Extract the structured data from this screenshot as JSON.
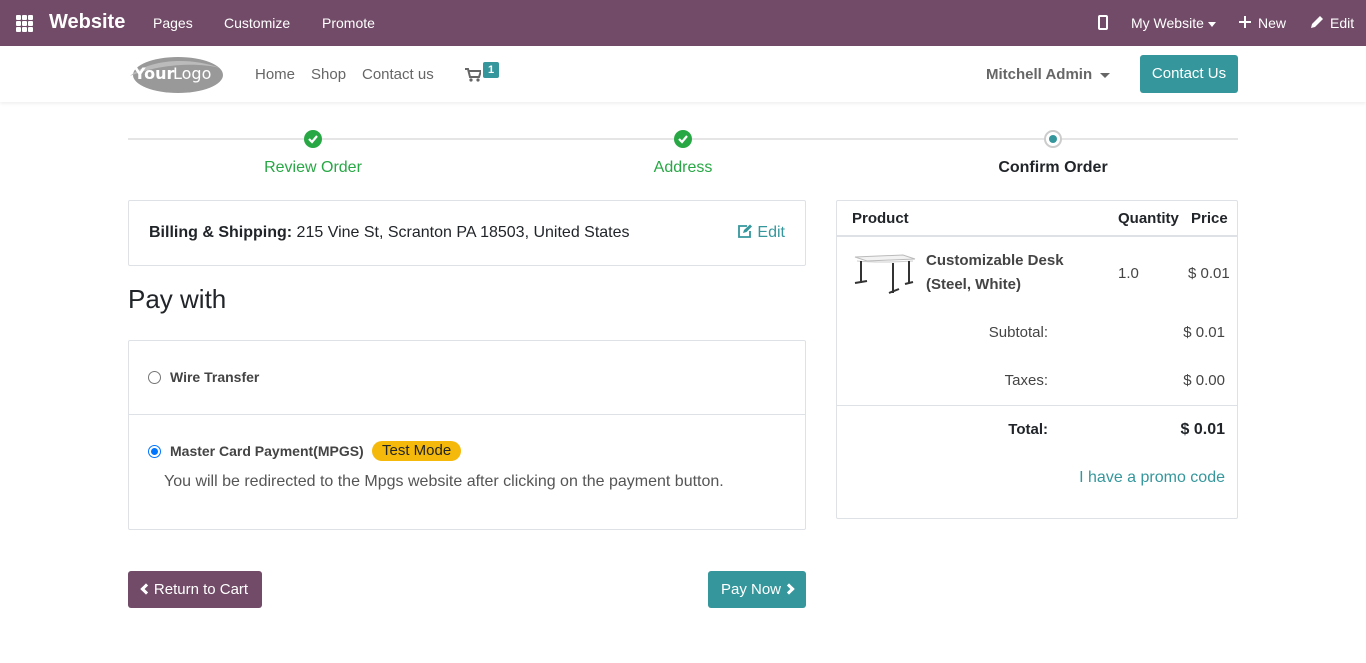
{
  "topbar": {
    "brand": "Website",
    "nav": [
      "Pages",
      "Customize",
      "Promote"
    ],
    "website_menu": "My Website",
    "new_label": "New",
    "edit_label": "Edit"
  },
  "header": {
    "logo_text": "YourLogo",
    "nav": [
      "Home",
      "Shop",
      "Contact us"
    ],
    "cart_count": "1",
    "user": "Mitchell Admin",
    "contact_btn": "Contact Us"
  },
  "steps": [
    {
      "label": "Review Order",
      "state": "done"
    },
    {
      "label": "Address",
      "state": "done"
    },
    {
      "label": "Confirm Order",
      "state": "current"
    }
  ],
  "billing": {
    "label": "Billing & Shipping:",
    "address": "215 Vine St, Scranton PA 18503, United States",
    "edit_label": "Edit"
  },
  "payment": {
    "title": "Pay with",
    "options": [
      {
        "label": "Wire Transfer",
        "checked": false
      },
      {
        "label": "Master Card Payment(MPGS)",
        "checked": true,
        "badge": "Test Mode",
        "help": "You will be redirected to the Mpgs website after clicking on the payment button."
      }
    ],
    "return_label": "Return to Cart",
    "pay_label": "Pay Now"
  },
  "summary": {
    "headers": {
      "product": "Product",
      "quantity": "Quantity",
      "price": "Price"
    },
    "lines": [
      {
        "name": "Customizable Desk (Steel, White)",
        "quantity": "1.0",
        "price": "$ 0.01"
      }
    ],
    "subtotal_label": "Subtotal:",
    "subtotal": "$ 0.01",
    "taxes_label": "Taxes:",
    "taxes": "$ 0.00",
    "total_label": "Total:",
    "total": "$ 0.01",
    "promo_label": "I have a promo code"
  },
  "colors": {
    "primary": "#714b67",
    "accent": "#35979c",
    "success": "#28a745",
    "badge": "#f5b90b"
  }
}
